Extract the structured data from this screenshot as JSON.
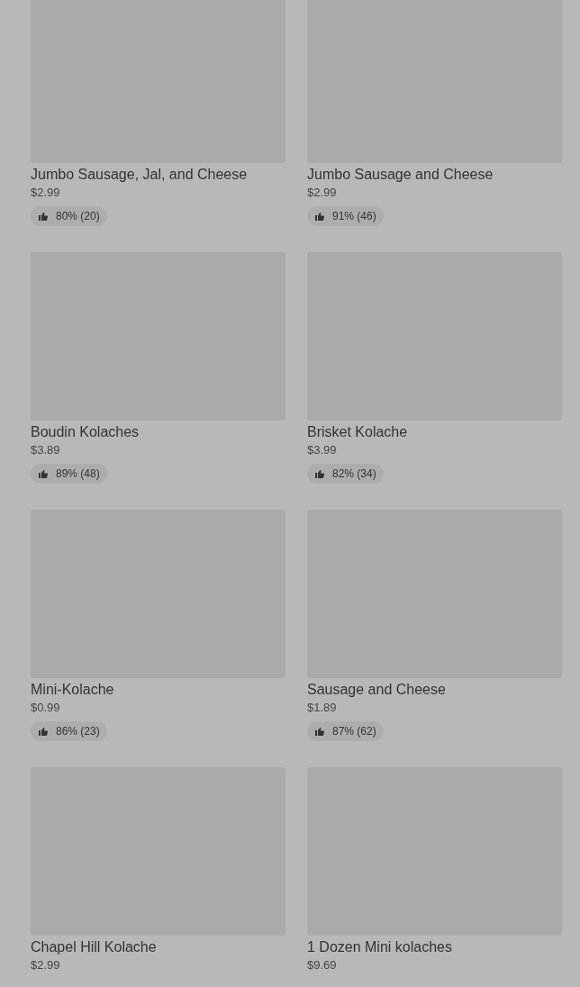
{
  "items": [
    {
      "name": "Jumbo Sausage, Jal, and Cheese",
      "price": "$2.99",
      "rating": "80% (20)"
    },
    {
      "name": "Jumbo Sausage and Cheese",
      "price": "$2.99",
      "rating": "91% (46)"
    },
    {
      "name": "Boudin Kolaches",
      "price": "$3.89",
      "rating": "89% (48)"
    },
    {
      "name": "Brisket Kolache",
      "price": "$3.99",
      "rating": "82% (34)"
    },
    {
      "name": "Mini-Kolache",
      "price": "$0.99",
      "rating": "86% (23)"
    },
    {
      "name": "Sausage and Cheese",
      "price": "$1.89",
      "rating": "87% (62)"
    },
    {
      "name": "Chapel Hill Kolache",
      "price": "$2.99"
    },
    {
      "name": "1 Dozen Mini kolaches",
      "price": "$9.69"
    }
  ]
}
